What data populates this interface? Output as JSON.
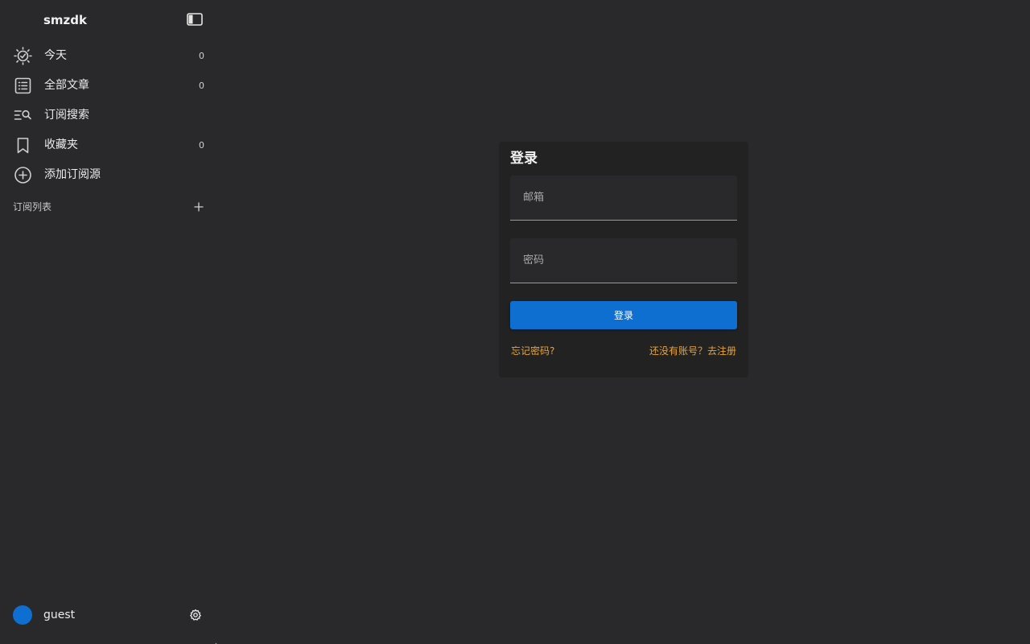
{
  "app": {
    "brand": "smzdk",
    "colors": {
      "background": "#29292b",
      "card": "#222223",
      "accent": "#0f6fd1",
      "link": "#e8a33a"
    }
  },
  "sidebar": {
    "items": [
      {
        "label": "今天",
        "count": "0",
        "icon": "today-sun-icon"
      },
      {
        "label": "全部文章",
        "count": "0",
        "icon": "article-list-icon"
      },
      {
        "label": "订阅搜索",
        "count": "",
        "icon": "feed-search-icon"
      },
      {
        "label": "收藏夹",
        "count": "0",
        "icon": "bookmark-icon"
      },
      {
        "label": "添加订阅源",
        "count": "",
        "icon": "add-circle-icon"
      }
    ],
    "section_label": "订阅列表",
    "user": {
      "name": "guest"
    }
  },
  "login": {
    "title": "登录",
    "email_placeholder": "邮箱",
    "password_placeholder": "密码",
    "submit_label": "登录",
    "forgot_label": "忘记密码?",
    "register_label": "还没有账号？去注册"
  }
}
